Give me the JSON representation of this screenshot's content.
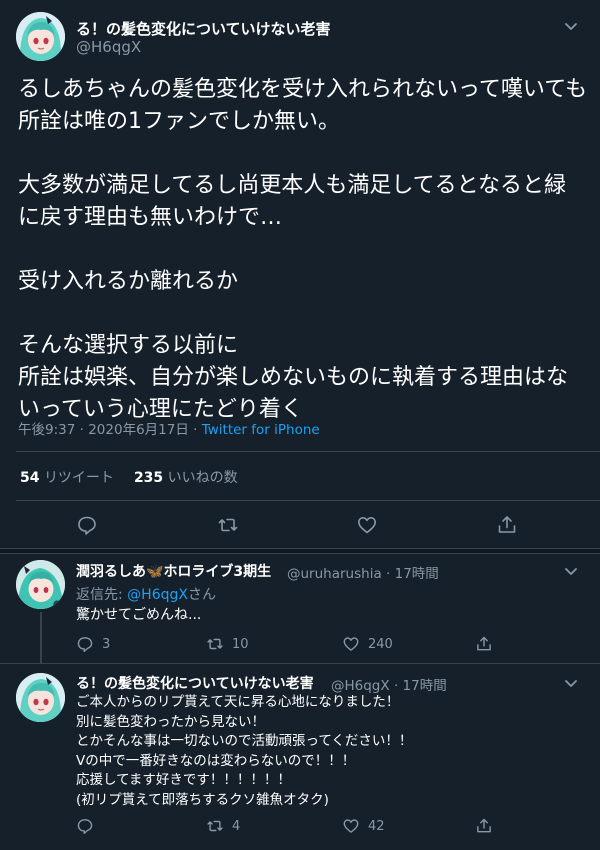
{
  "main_tweet": {
    "display_name": "る！の髪色変化についていけない老害",
    "handle": "@H6qgX",
    "text": "るしあちゃんの髪色変化を受け入れられないって嘆いても所詮は唯の1ファンでしか無い。\n\n大多数が満足してるし尚更本人も満足してるとなると緑に戻す理由も無いわけで…\n\n受け入れるか離れるか\n\nそんな選択する以前に\n所詮は娯楽、自分が楽しめないものに執着する理由はないっていう心理にたどり着く",
    "time": "午後9:37",
    "sep": "·",
    "date": "2020年6月17日",
    "sep2": "·",
    "source": "Twitter for iPhone",
    "retweets_count": "54",
    "retweets_label": "リツイート",
    "likes_count": "235",
    "likes_label": "いいねの数"
  },
  "reply1": {
    "display_name_a": "潤羽るしあ",
    "butterfly": "🦋",
    "display_name_b": "ホロライブ3期生",
    "handle": "@uruharushia",
    "sep": "·",
    "time": "17時間",
    "reply_prefix": "返信先: ",
    "reply_handle": "@H6qgX",
    "reply_suffix": "さん",
    "text": "驚かせてごめんね...",
    "reply_count": "3",
    "retweet_count": "10",
    "like_count": "240"
  },
  "reply2": {
    "display_name": "る！の髪色変化についていけない老害",
    "handle": "@H6qgX",
    "sep": "·",
    "time": "17時間",
    "text": "ご本人からのリプ貰えて天に昇る心地になりました！\n別に髪色変わったから見ない！\nとかそんな事は一切ないので活動頑張ってください！！\nVの中で一番好きなのは変わらないので！！！\n応援してます好きです！！！！！！\n(初リプ貰えて即落ちするクソ雑魚オタク)",
    "reply_count": "",
    "retweet_count": "4",
    "like_count": "42"
  },
  "colors": {
    "background": "#15202b",
    "text": "#ffffff",
    "muted": "#8899a6",
    "link": "#1da1f2",
    "divider": "#38444d"
  },
  "icons": [
    "chevron-down-icon",
    "reply-icon",
    "retweet-icon",
    "like-icon",
    "share-icon"
  ]
}
